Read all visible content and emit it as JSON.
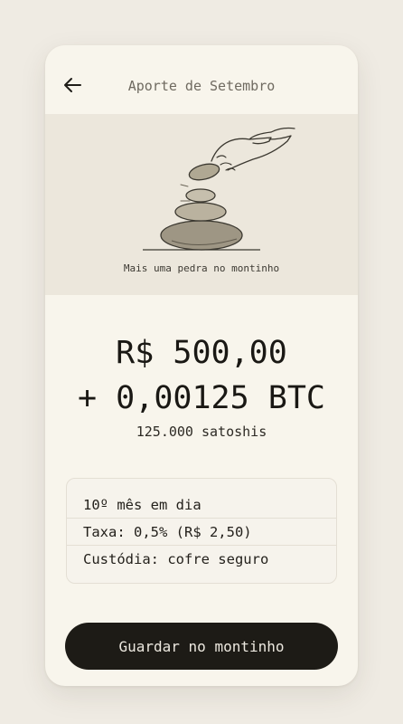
{
  "header": {
    "title": "Aporte de Setembro",
    "back_icon": "arrow-left-icon"
  },
  "illustration": {
    "icon": "hand-stacking-stones-icon",
    "caption": "Mais uma pedra no montinho"
  },
  "amount": {
    "fiat": "R$ 500,00",
    "btc": "+ 0,00125 BTC",
    "sats": "125.000 satoshis"
  },
  "details": {
    "rows": [
      "10º mês em dia",
      "Taxa: 0,5% (R$ 2,50)",
      "Custódia: cofre seguro"
    ]
  },
  "cta": {
    "label": "Guardar no montinho"
  },
  "colors": {
    "background": "#efebe3",
    "card": "#f8f5ec",
    "illustration_bg": "#ece7dc",
    "button": "#1d1b16",
    "button_text": "#ece8df"
  }
}
